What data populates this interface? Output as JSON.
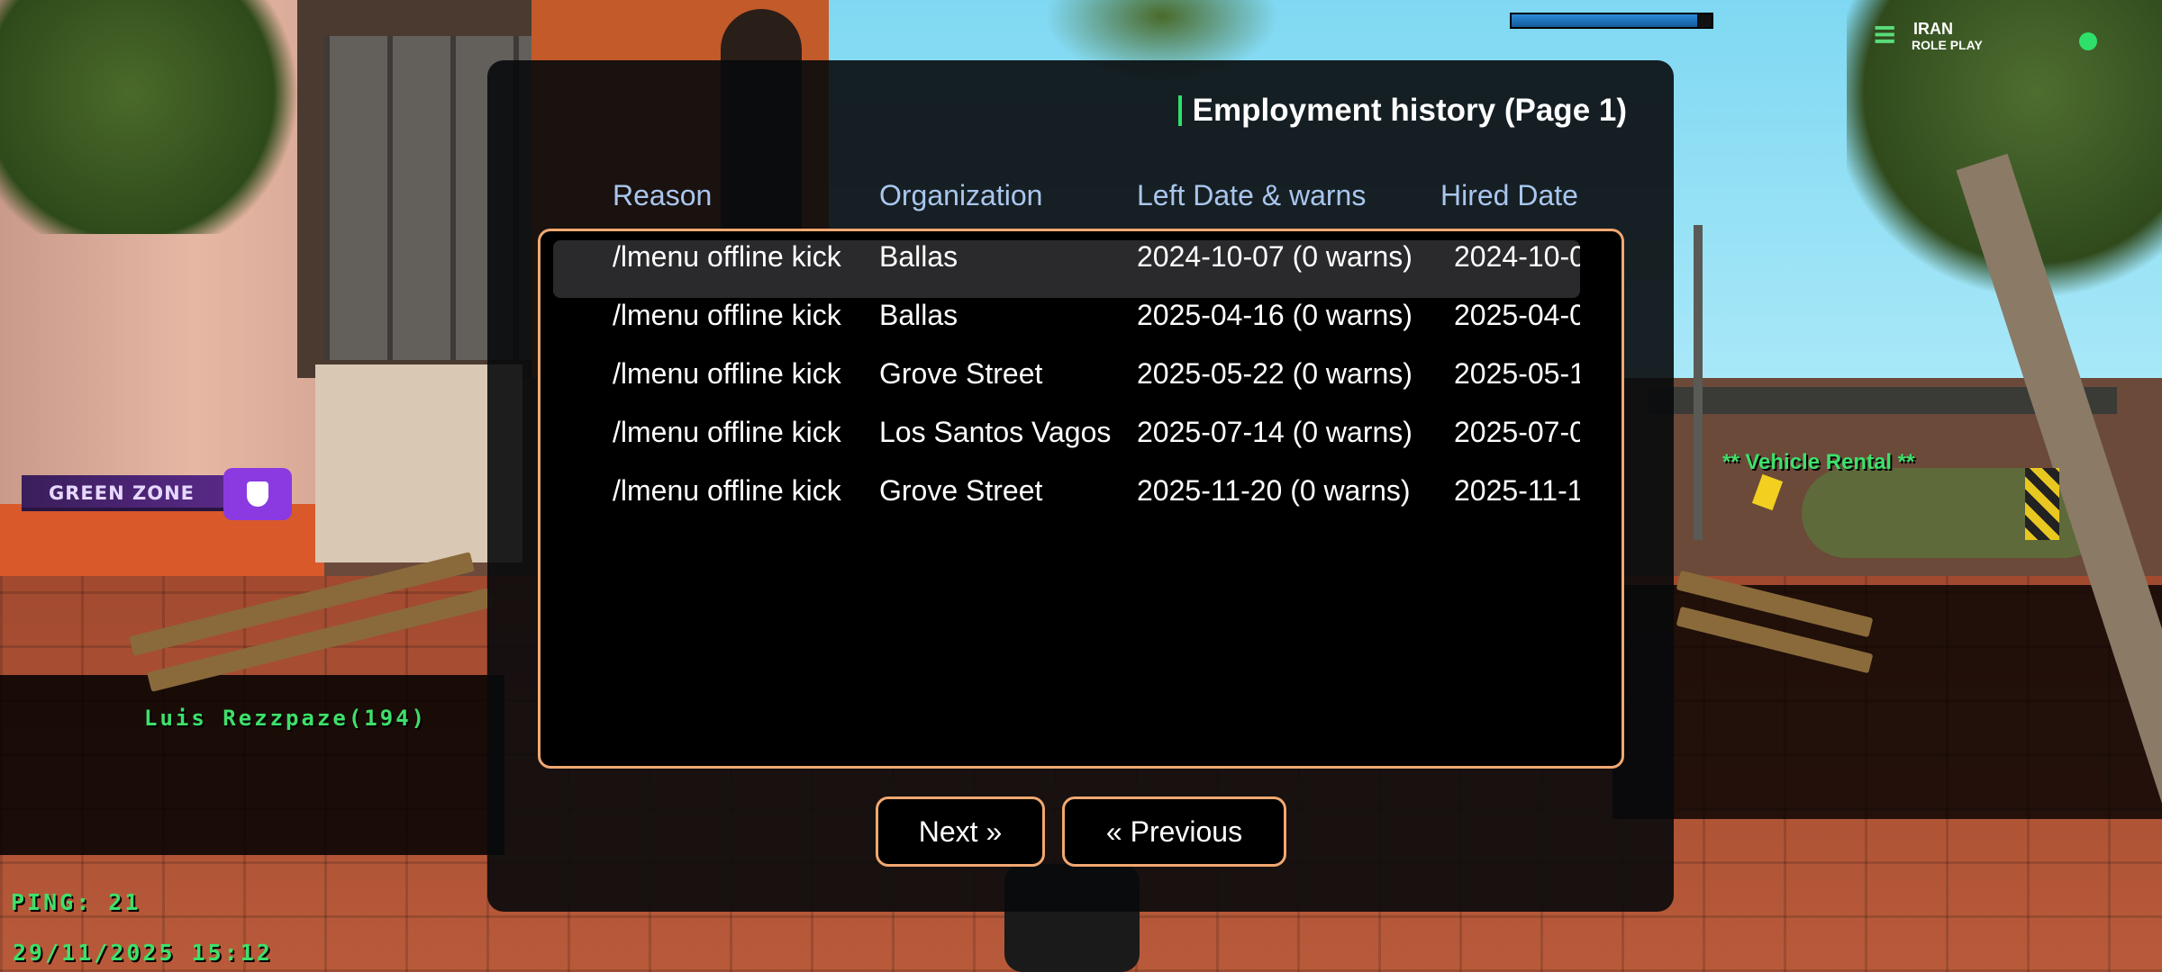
{
  "hud": {
    "health_bar_fraction": 0.93,
    "logo_line1": "IRAN",
    "logo_line2": "ROLE PLAY",
    "zone_label": "GREEN ZONE",
    "player_tag": "Luis Rezzpaze(194)",
    "vehicle_rental": "**  Vehicle Rental **",
    "ping": "PING: 21",
    "datetime": "29/11/2025 15:12"
  },
  "dialog": {
    "title": "Employment history (Page 1)",
    "columns": [
      "Reason",
      "Organization",
      "Left Date & warns",
      "Hired Date"
    ],
    "rows": [
      {
        "reason": "/lmenu offline kick",
        "organization": "Ballas",
        "left": "2024-10-07 (0 warns)",
        "hired": "2024-10-0"
      },
      {
        "reason": "/lmenu offline kick",
        "organization": "Ballas",
        "left": "2025-04-16 (0 warns)",
        "hired": "2025-04-0"
      },
      {
        "reason": "/lmenu offline kick",
        "organization": "Grove Street",
        "left": "2025-05-22 (0 warns)",
        "hired": "2025-05-1"
      },
      {
        "reason": "/lmenu offline kick",
        "organization": "Los Santos Vagos",
        "left": "2025-07-14 (0 warns)",
        "hired": "2025-07-0"
      },
      {
        "reason": "/lmenu offline kick",
        "organization": "Grove Street",
        "left": "2025-11-20 (0 warns)",
        "hired": "2025-11-1"
      }
    ],
    "selected_row": 0,
    "next_label": "Next »",
    "previous_label": "« Previous"
  },
  "colors": {
    "accent_green": "#2ee06a",
    "button_border": "#f2a870",
    "header_text": "#a9c6ee"
  }
}
